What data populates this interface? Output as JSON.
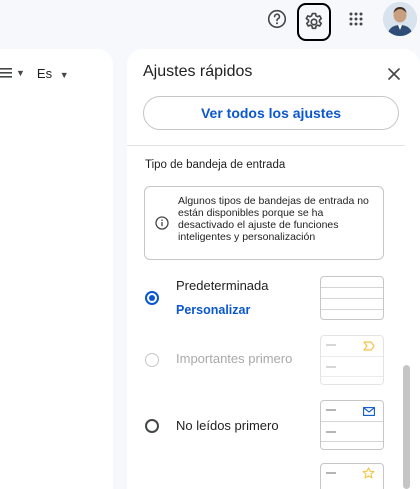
{
  "topbar": {
    "help_icon": "help-circle-icon",
    "settings_icon": "gear-icon",
    "apps_icon": "apps-grid-icon",
    "avatar": "user-avatar"
  },
  "mail_toolbar": {
    "density_icon": "density-lines-icon",
    "language_label": "Es"
  },
  "quick_settings": {
    "title": "Ajustes rápidos",
    "see_all_label": "Ver todos los ajustes",
    "inbox_type_title": "Tipo de bandeja de entrada",
    "info_text": "Algunos tipos de bandejas de entrada no están disponibles porque se ha desactivado el ajuste de funciones inteligentes y personalización",
    "options": [
      {
        "label": "Predeterminada",
        "state": "checked",
        "link": "Personalizar"
      },
      {
        "label": "Importantes primero",
        "state": "disabled"
      },
      {
        "label": "No leídos primero",
        "state": "unchecked"
      }
    ],
    "colors": {
      "accent": "#0b57d0",
      "important_marker": "#f6c445"
    }
  }
}
